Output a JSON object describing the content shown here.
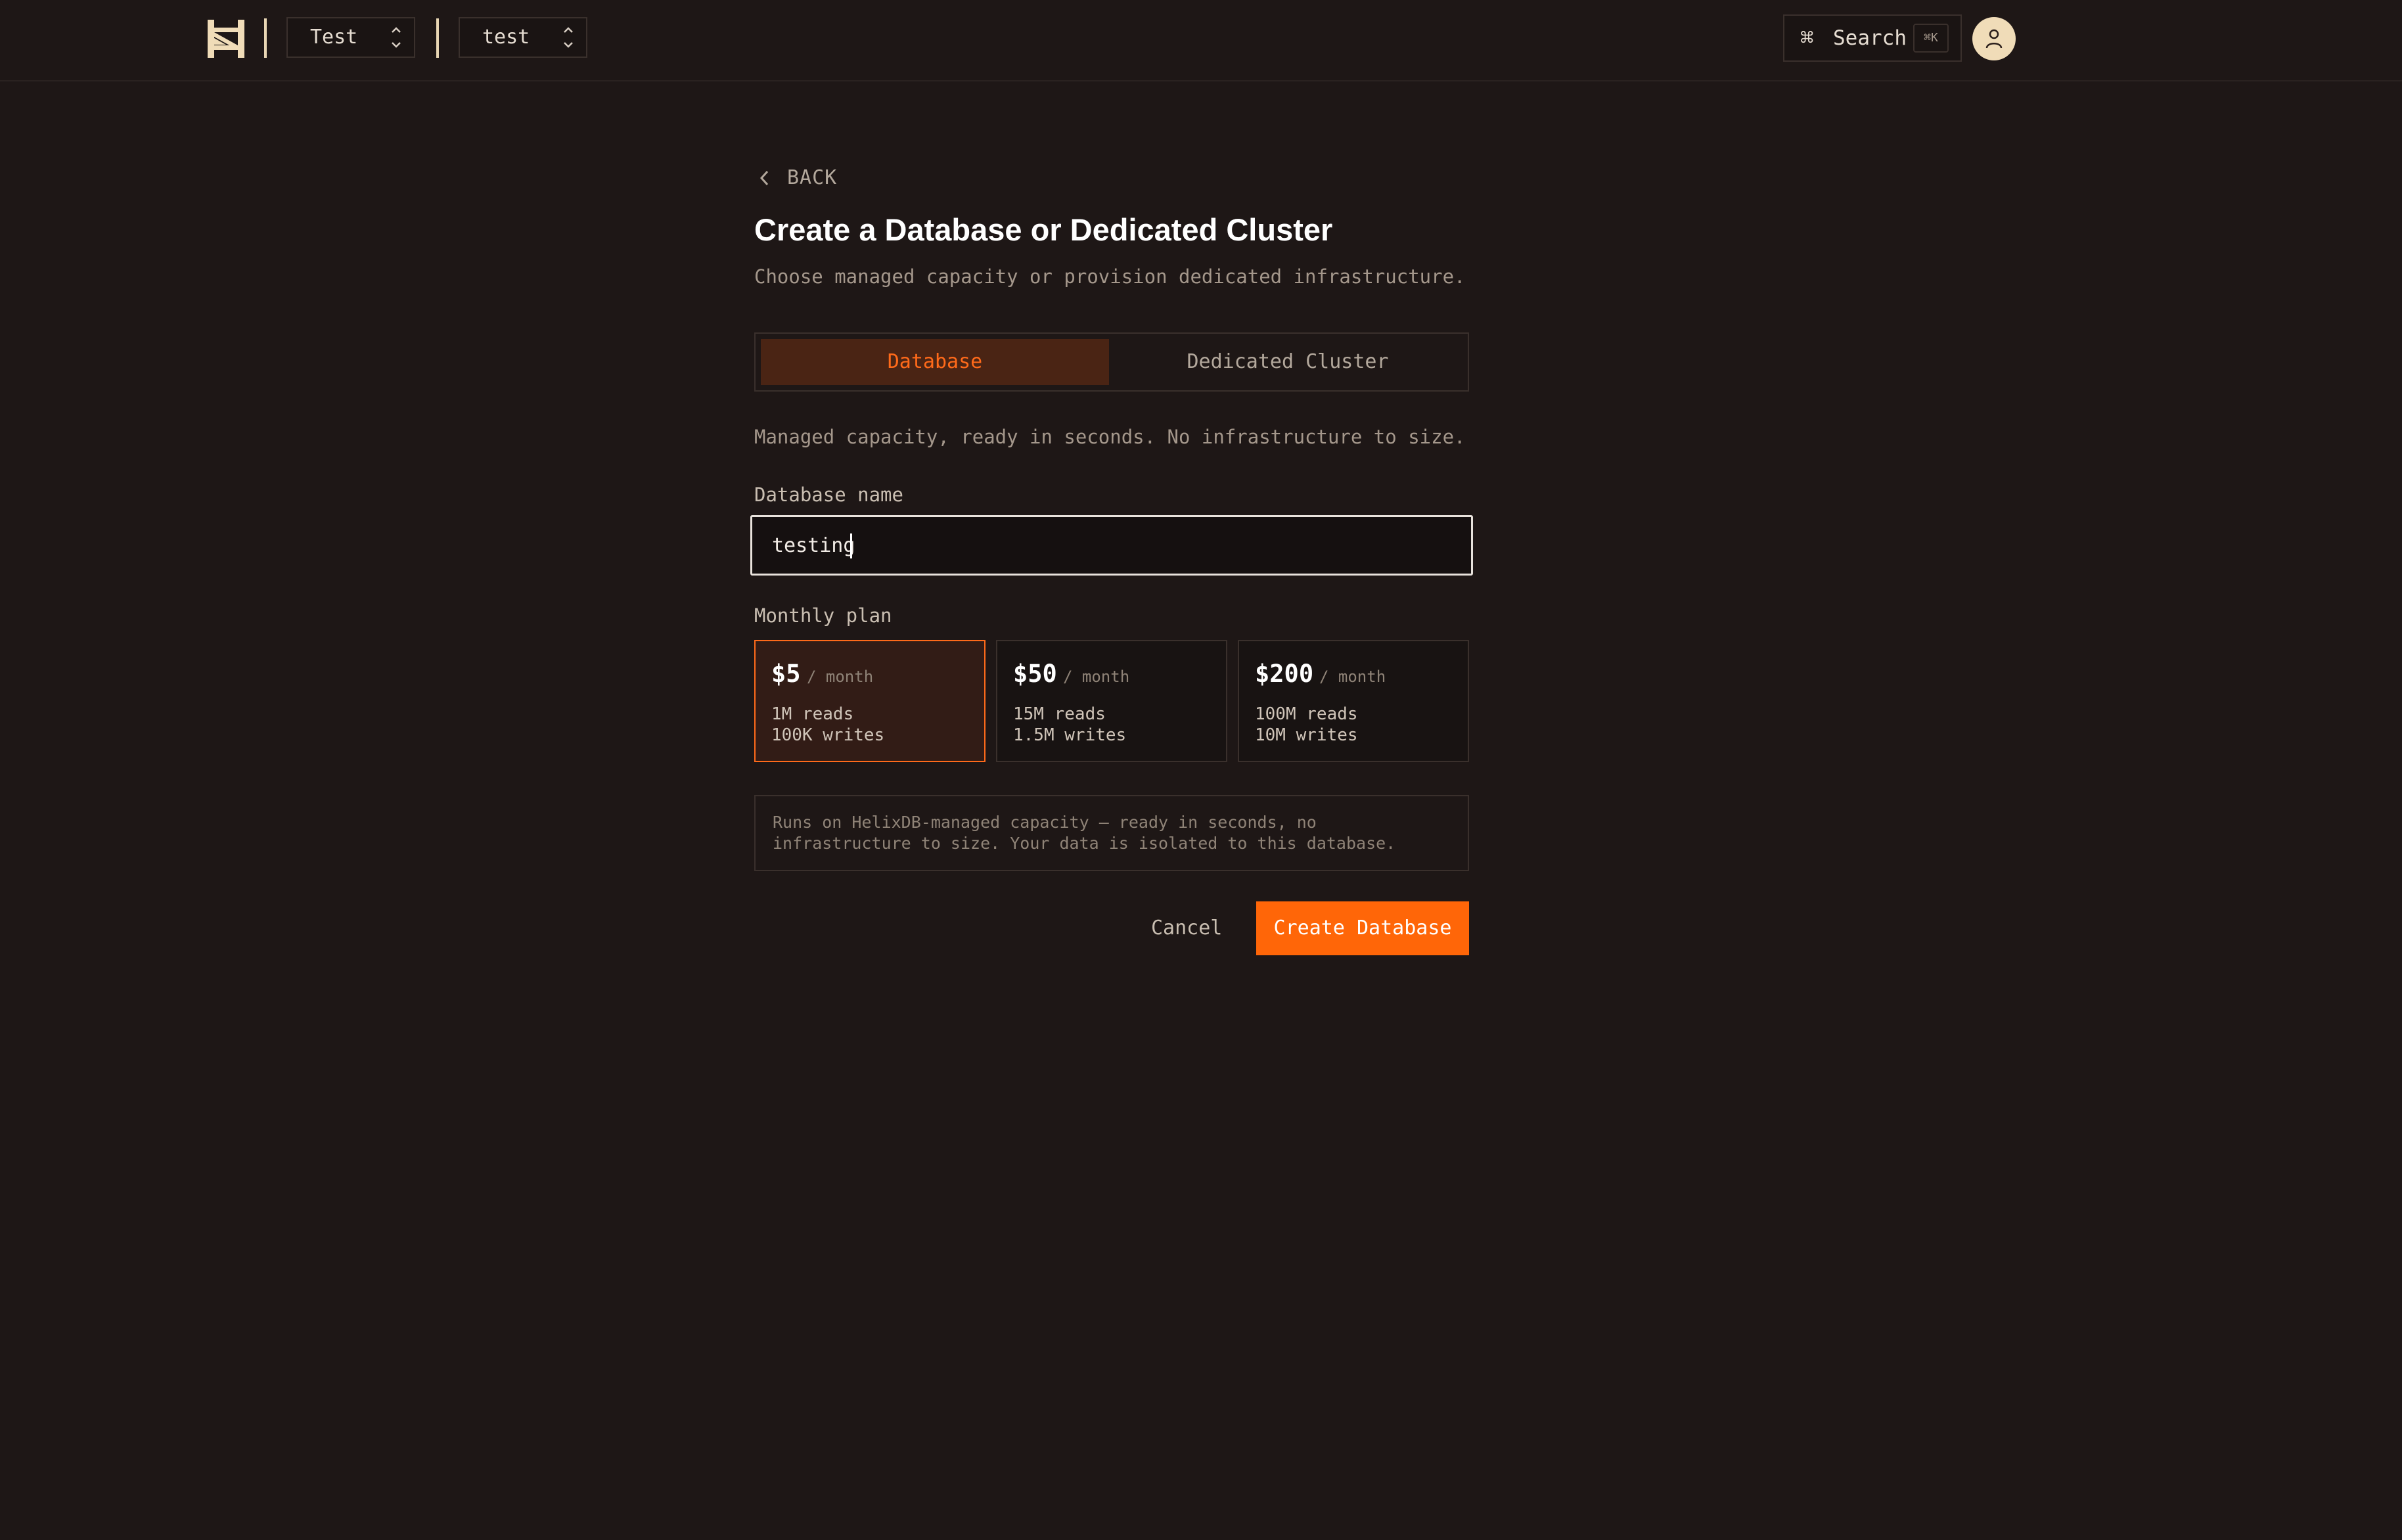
{
  "header": {
    "logo_icon": "helix-logo-icon",
    "org_switcher": {
      "label": "Test"
    },
    "project_switcher": {
      "label": "test"
    },
    "search": {
      "label": "Search",
      "shortcut": "⌘K",
      "cmd_glyph": "⌘"
    },
    "avatar_icon": "user-icon"
  },
  "page": {
    "back_label": "BACK",
    "title": "Create a Database or Dedicated Cluster",
    "subtitle": "Choose managed capacity or provision dedicated infrastructure.",
    "tabs": [
      {
        "label": "Database",
        "active": true
      },
      {
        "label": "Dedicated Cluster",
        "active": false
      }
    ],
    "tab_description": "Managed capacity, ready in seconds. No infrastructure to size.",
    "name_field": {
      "label": "Database name",
      "value": "testing"
    },
    "plan_label": "Monthly plan",
    "plans": [
      {
        "price": "$5",
        "per": "/ month",
        "reads": "1M reads",
        "writes": "100K writes",
        "selected": true
      },
      {
        "price": "$50",
        "per": "/ month",
        "reads": "15M reads",
        "writes": "1.5M writes",
        "selected": false
      },
      {
        "price": "$200",
        "per": "/ month",
        "reads": "100M reads",
        "writes": "10M writes",
        "selected": false
      }
    ],
    "info_text": "Runs on HelixDB-managed capacity — ready in seconds, no infrastructure to size. Your data is isolated to this database.",
    "cancel_label": "Cancel",
    "create_label": "Create Database"
  },
  "colors": {
    "background": "#1e1716",
    "accent": "#ff6608",
    "active_tab_bg": "#4a2414",
    "selected_plan_bg": "#321c16",
    "logo": "#f0dcb8"
  }
}
